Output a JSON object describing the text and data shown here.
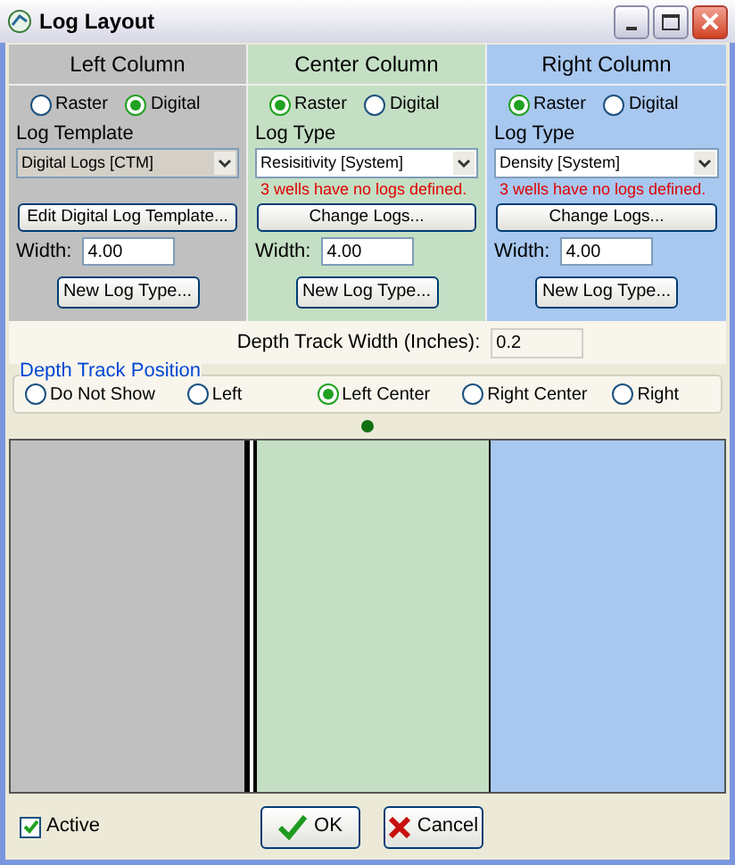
{
  "window": {
    "title": "Log Layout"
  },
  "columns": [
    {
      "header": "Left Column",
      "color": "#c0c0c0",
      "modes": [
        {
          "label": "Raster",
          "selected": false
        },
        {
          "label": "Digital",
          "selected": true
        }
      ],
      "field_label": "Log Template",
      "dropdown": "Digital Logs [CTM]",
      "dropdown_disabled": true,
      "button": "Edit Digital Log Template...",
      "width_label": "Width:",
      "width_value": "4.00",
      "new_button": "New Log Type..."
    },
    {
      "header": "Center Column",
      "color": "#c4dfc4",
      "modes": [
        {
          "label": "Raster",
          "selected": true
        },
        {
          "label": "Digital",
          "selected": false
        }
      ],
      "field_label": "Log Type",
      "dropdown": "Resisitivity [System]",
      "dropdown_disabled": false,
      "warning": "3 wells have no logs defined.",
      "button": "Change Logs...",
      "width_label": "Width:",
      "width_value": "4.00",
      "new_button": "New Log Type..."
    },
    {
      "header": "Right Column",
      "color": "#a8c8f0",
      "modes": [
        {
          "label": "Raster",
          "selected": true
        },
        {
          "label": "Digital",
          "selected": false
        }
      ],
      "field_label": "Log Type",
      "dropdown": "Density [System]",
      "dropdown_disabled": false,
      "warning": "3 wells have no logs defined.",
      "button": "Change Logs...",
      "width_label": "Width:",
      "width_value": "4.00",
      "new_button": "New Log Type..."
    }
  ],
  "depth_track_width": {
    "label": "Depth Track Width (Inches):",
    "value": "0.2"
  },
  "depth_track_position": {
    "title": "Depth Track Position",
    "options": [
      {
        "label": "Do Not Show",
        "selected": false
      },
      {
        "label": "Left",
        "selected": false
      },
      {
        "label": "Left Center",
        "selected": true
      },
      {
        "label": "Right Center",
        "selected": false
      },
      {
        "label": "Right",
        "selected": false
      }
    ]
  },
  "active": {
    "label": "Active",
    "checked": true
  },
  "buttons": [
    {
      "kind": "ok",
      "label": "OK"
    },
    {
      "kind": "cancel",
      "label": "Cancel"
    }
  ]
}
